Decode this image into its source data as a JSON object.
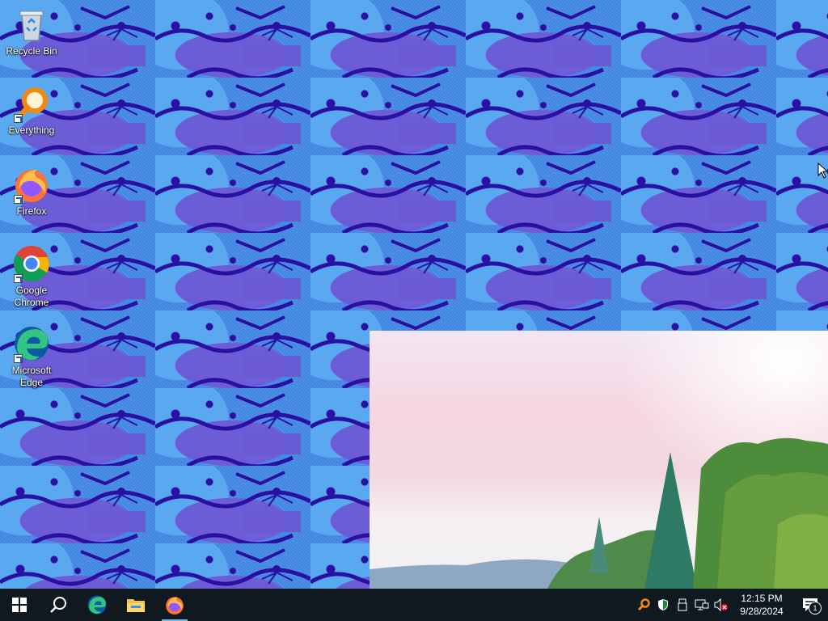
{
  "desktop": {
    "icons": [
      {
        "label": "Recycle Bin",
        "icon": "recycle-bin-icon"
      },
      {
        "label": "Everything",
        "icon": "everything-search-icon"
      },
      {
        "label": "Firefox",
        "icon": "firefox-icon"
      },
      {
        "label": "Google Chrome",
        "icon": "chrome-icon"
      },
      {
        "label": "Microsoft Edge",
        "icon": "edge-icon"
      }
    ]
  },
  "taskbar": {
    "buttons": [
      {
        "name": "start",
        "icon": "windows-logo-icon"
      },
      {
        "name": "search",
        "icon": "search-icon"
      },
      {
        "name": "edge",
        "icon": "edge-icon"
      },
      {
        "name": "file-explorer",
        "icon": "folder-icon"
      },
      {
        "name": "firefox",
        "icon": "firefox-icon",
        "active": true
      }
    ],
    "tray": {
      "icons": [
        "everything-search-icon",
        "defender-shield-icon",
        "usb-drive-icon",
        "network-icon",
        "volume-muted-icon"
      ],
      "time": "12:15 PM",
      "date": "9/28/2024",
      "notification_count": "1"
    }
  },
  "colors": {
    "taskbar_bg": "#101820",
    "accent": "#76b9ed",
    "wallpaper_blue": "#4a8fe8",
    "wallpaper_purple": "#6c5cd6"
  }
}
